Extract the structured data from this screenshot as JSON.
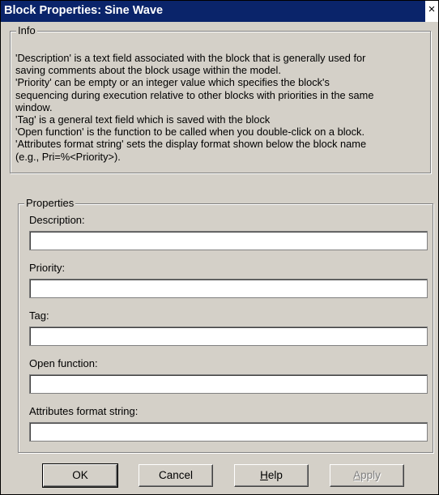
{
  "window": {
    "title": "Block Properties: Sine Wave",
    "close_glyph": "×",
    "titlebar_color": "#0a246a",
    "face_color": "#d4d0c8"
  },
  "info": {
    "legend": "Info",
    "lines": [
      "'Description' is a text field associated with the block that is generally used for",
      "saving comments about the block usage within the model.",
      "'Priority' can be empty or an integer value which specifies the block's",
      "sequencing during execution relative to other blocks with priorities in the same",
      "window.",
      "'Tag' is a general text field which is saved with the block",
      "'Open function' is the function to be called when you double-click on a block.",
      "'Attributes format string' sets the display format shown below the block name",
      "(e.g., Pri=%<Priority>)."
    ]
  },
  "properties": {
    "legend": "Properties",
    "description": {
      "label": "Description:",
      "value": ""
    },
    "priority": {
      "label": "Priority:",
      "value": ""
    },
    "tag": {
      "label": "Tag:",
      "value": ""
    },
    "open_function": {
      "label": "Open function:",
      "value": ""
    },
    "attributes_format": {
      "label": "Attributes format string:",
      "value": ""
    }
  },
  "buttons": {
    "ok": "OK",
    "cancel": "Cancel",
    "help_underlined": "H",
    "help_rest": "elp",
    "apply_underlined": "A",
    "apply_rest": "pply"
  }
}
